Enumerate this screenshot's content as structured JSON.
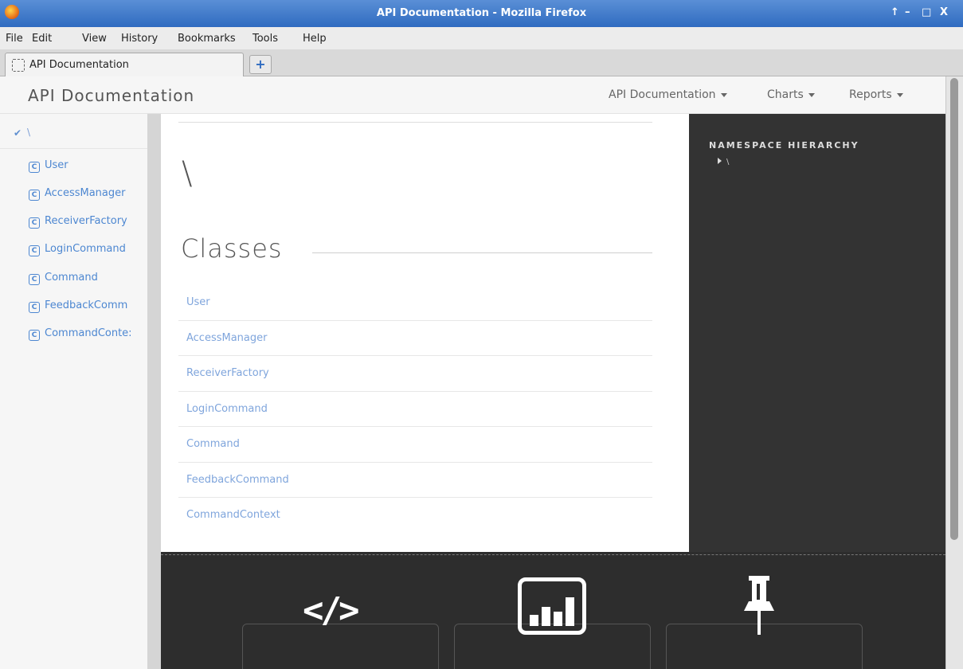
{
  "window": {
    "title": "API Documentation - Mozilla Firefox",
    "controls": [
      "↑",
      "–",
      "□",
      "X"
    ]
  },
  "menu": [
    "File",
    "Edit",
    "View",
    "History",
    "Bookmarks",
    "Tools",
    "Help"
  ],
  "tab": {
    "label": "API Documentation",
    "new_tab": "+"
  },
  "navbar": {
    "brand": "API Documentation",
    "links": [
      "API Documentation",
      "Charts",
      "Reports"
    ]
  },
  "sidebar": {
    "root_label": "\\",
    "class_icon": "C",
    "items": [
      "User",
      "AccessManager",
      "ReceiverFactory",
      "LoginCommand",
      "Command",
      "FeedbackComm",
      "CommandConte:"
    ]
  },
  "main": {
    "namespace_title": "\\",
    "classes_heading": "Classes",
    "classes": [
      "User",
      "AccessManager",
      "ReceiverFactory",
      "LoginCommand",
      "Command",
      "FeedbackCommand",
      "CommandContext"
    ]
  },
  "right_panel": {
    "heading": "NAMESPACE HIERARCHY",
    "node": "\\"
  },
  "footer": {
    "code_glyph": "</>",
    "icons": [
      "code-icon",
      "chart-icon",
      "pin-icon"
    ]
  }
}
